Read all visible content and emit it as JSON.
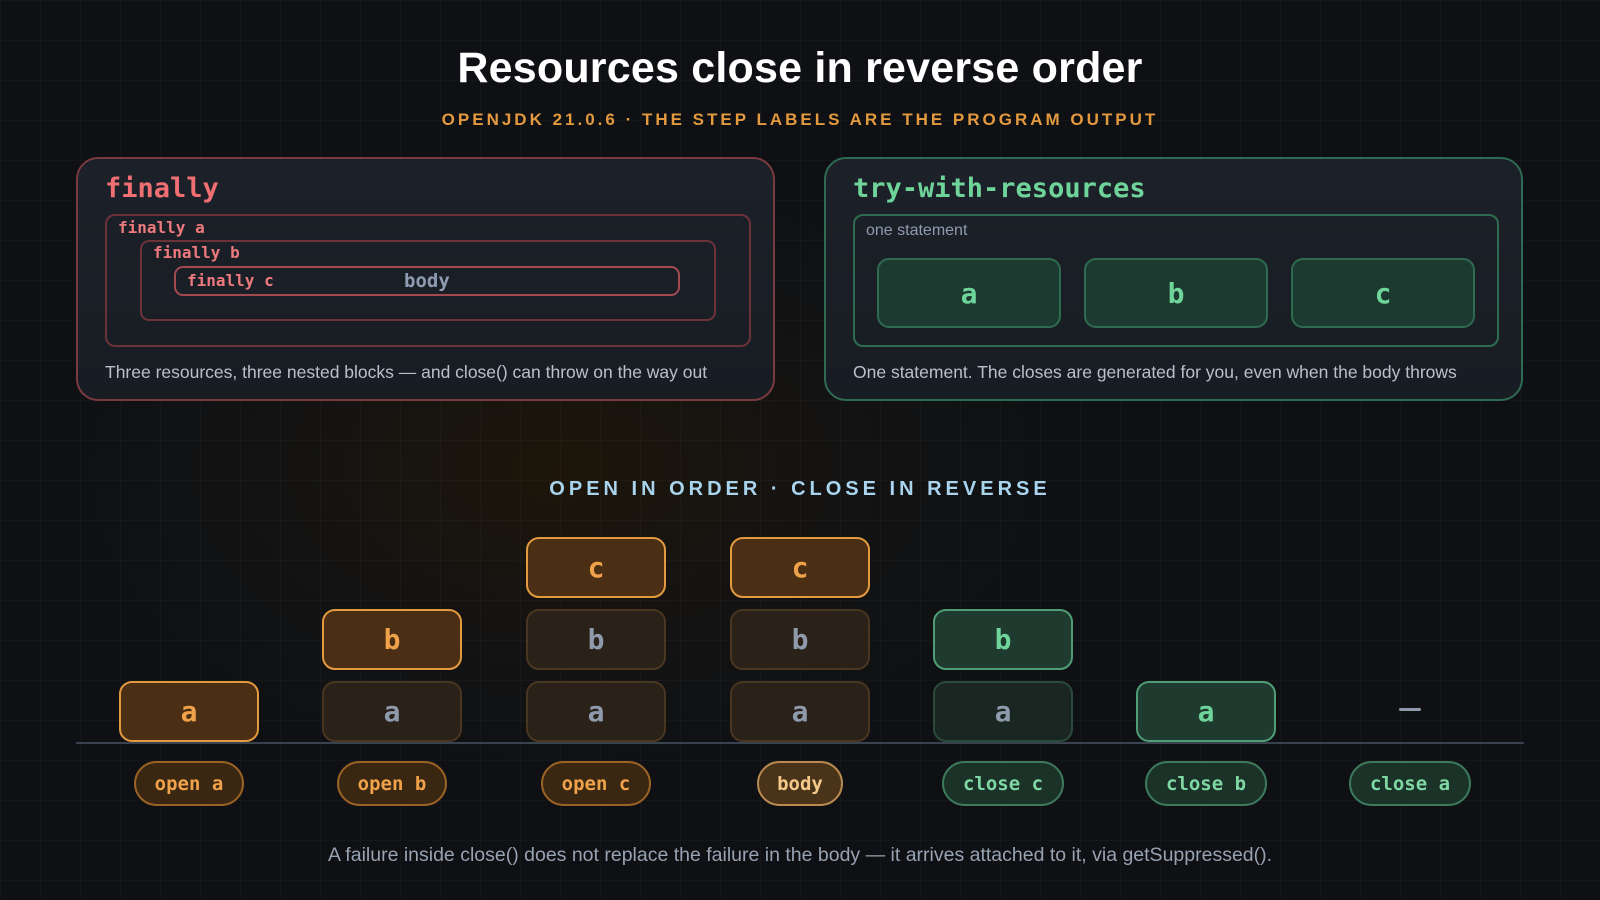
{
  "title": "Resources close in reverse order",
  "subtitle": "OPENJDK 21.0.6 · THE STEP LABELS ARE THE PROGRAM OUTPUT",
  "finally_card": {
    "title": "finally",
    "nested_labels": [
      "finally a",
      "finally b",
      "finally c"
    ],
    "body_label": "body",
    "caption": "Three resources, three nested blocks — and close() can throw on the way out"
  },
  "twr_card": {
    "title": "try-with-resources",
    "statement_label": "one statement",
    "resources": [
      "a",
      "b",
      "c"
    ],
    "caption": "One statement. The closes are generated for you, even when the body throws"
  },
  "section_heading": "OPEN IN ORDER · CLOSE IN REVERSE",
  "steps": [
    {
      "label": "open a",
      "stack": [
        "a"
      ],
      "highlight": "a"
    },
    {
      "label": "open b",
      "stack": [
        "a",
        "b"
      ],
      "highlight": "b"
    },
    {
      "label": "open c",
      "stack": [
        "a",
        "b",
        "c"
      ],
      "highlight": "c"
    },
    {
      "label": "body",
      "stack": [
        "a",
        "b",
        "c"
      ],
      "highlight": "c"
    },
    {
      "label": "close c",
      "stack": [
        "a",
        "b"
      ],
      "highlight": "b"
    },
    {
      "label": "close b",
      "stack": [
        "a"
      ],
      "highlight": "a"
    },
    {
      "label": "close a",
      "stack": [],
      "empty_marker": "—"
    }
  ],
  "footer": "A failure inside close() does not replace the failure in the body — it arrives attached to it, via getSuppressed().",
  "colors": {
    "accent_orange": "#e39a3f",
    "finally_red": "#ef6f73",
    "twr_green": "#6fd49a",
    "heading_blue": "#a9d4ee"
  }
}
